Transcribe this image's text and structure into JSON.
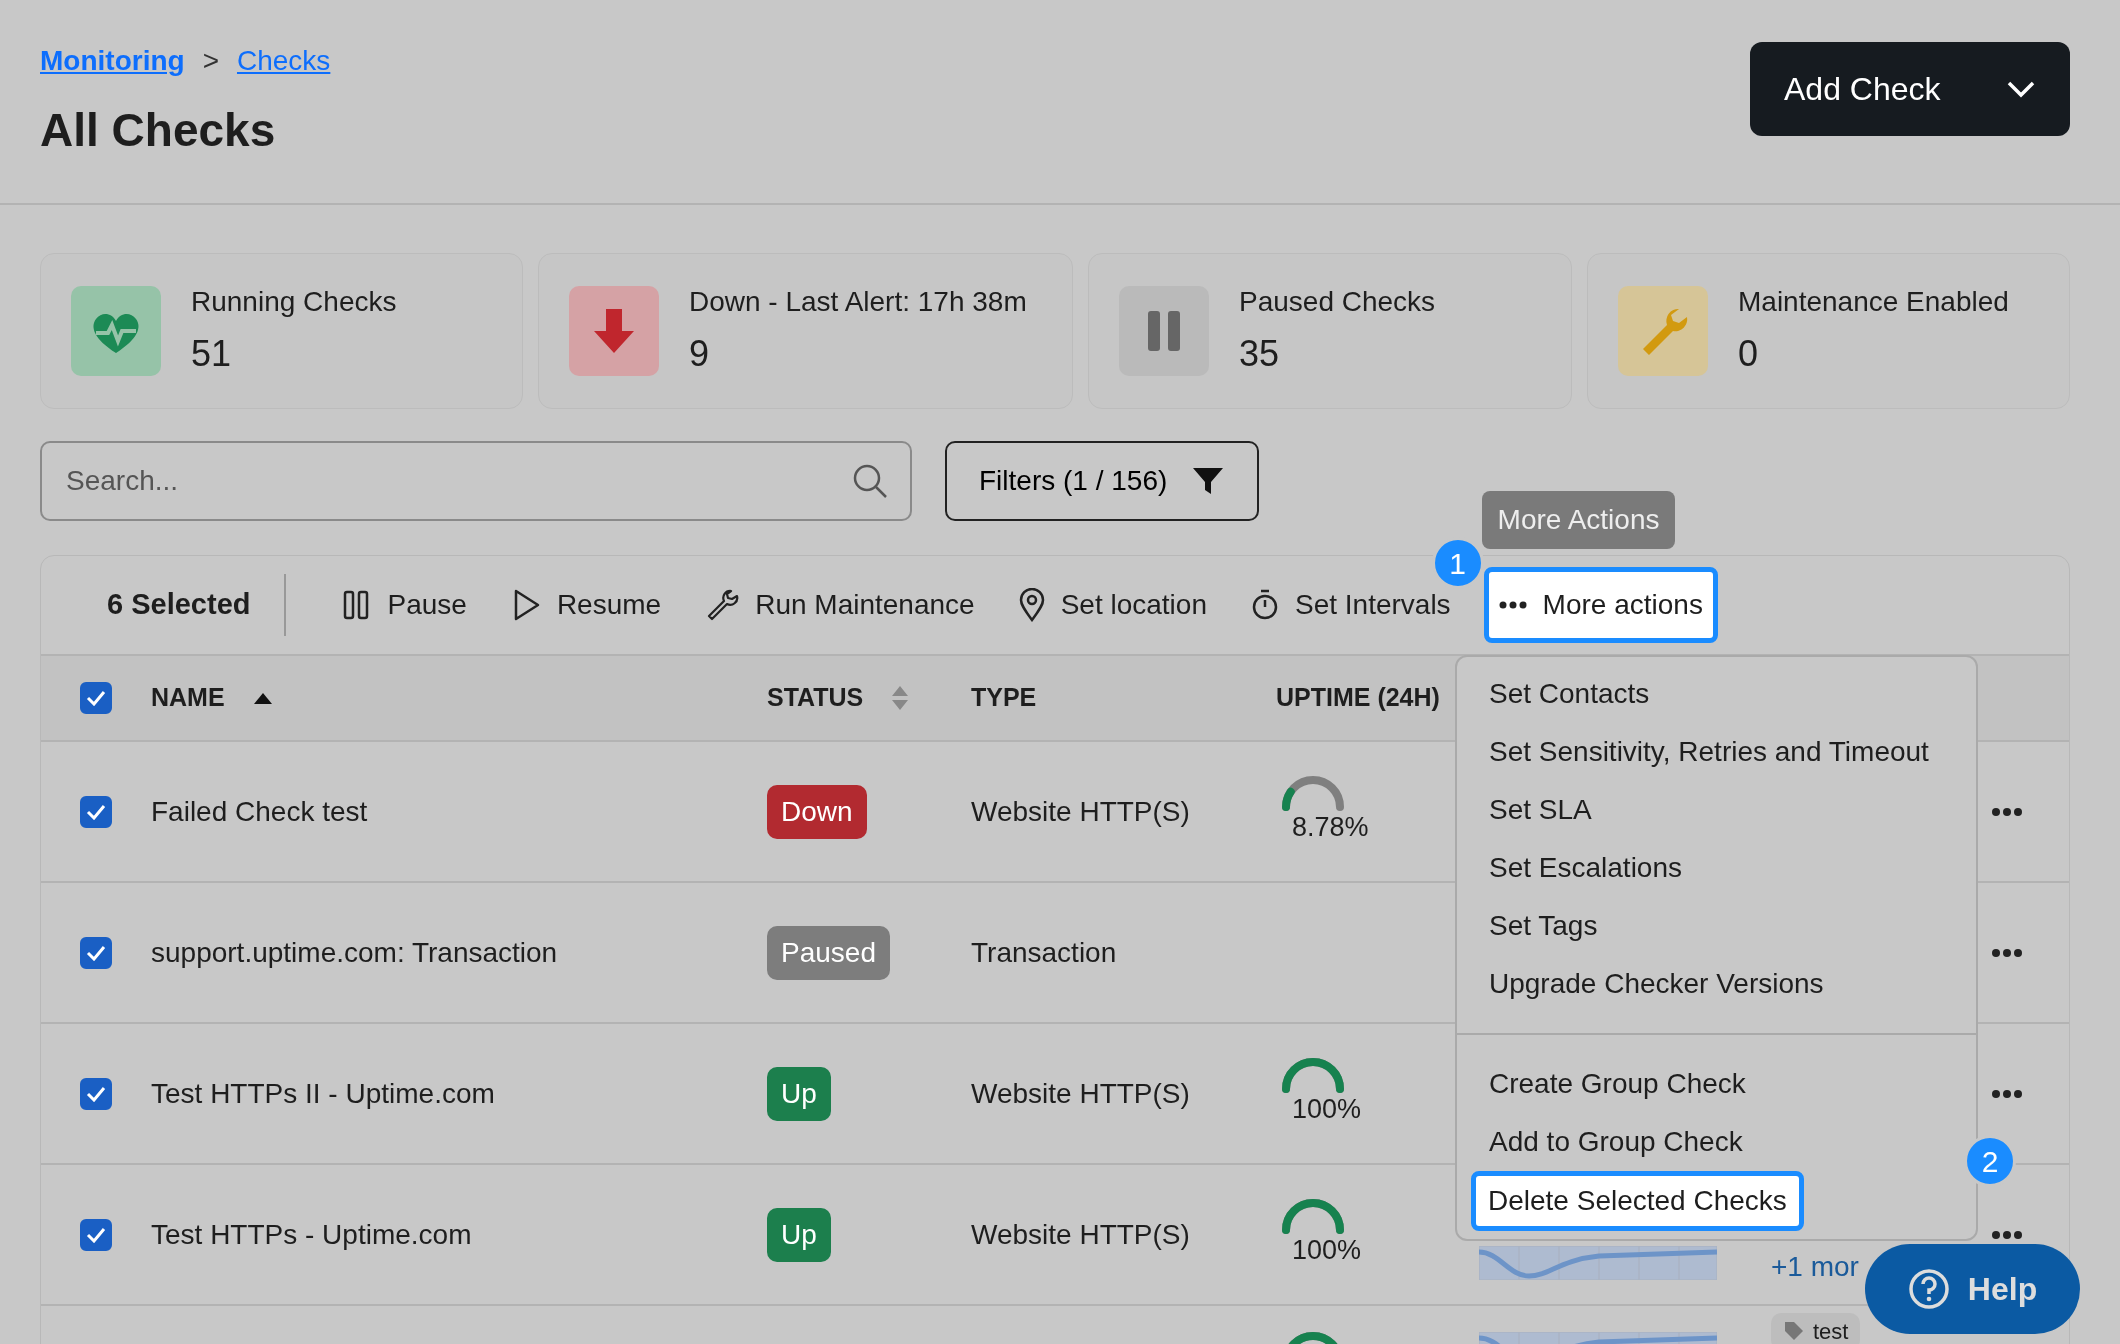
{
  "breadcrumb": [
    {
      "label": "Monitoring"
    },
    {
      "label": "Checks"
    }
  ],
  "breadcrumb_separator": ">",
  "title": "All Checks",
  "add_button": {
    "label": "Add Check"
  },
  "stats": [
    {
      "kind": "running",
      "label": "Running Checks",
      "value": "51"
    },
    {
      "kind": "down",
      "label": "Down - Last Alert: 17h 38m",
      "value": "9"
    },
    {
      "kind": "paused",
      "label": "Paused Checks",
      "value": "35"
    },
    {
      "kind": "maintenance",
      "label": "Maintenance Enabled",
      "value": "0"
    }
  ],
  "search": {
    "placeholder": "Search..."
  },
  "filters": {
    "label": "Filters (1 / 156)"
  },
  "toolbar": {
    "selected_count": "6 Selected",
    "actions": [
      {
        "kind": "pause",
        "label": "Pause",
        "highlighted": false
      },
      {
        "kind": "resume",
        "label": "Resume",
        "highlighted": false
      },
      {
        "kind": "maintenance",
        "label": "Run Maintenance",
        "highlighted": false
      },
      {
        "kind": "location",
        "label": "Set location",
        "highlighted": false
      },
      {
        "kind": "intervals",
        "label": "Set Intervals",
        "highlighted": false
      },
      {
        "kind": "more",
        "label": "More actions",
        "highlighted": true,
        "callout": "1",
        "tooltip": "More Actions"
      }
    ]
  },
  "table": {
    "select_all_checked": true,
    "columns": [
      {
        "label": "NAME",
        "sortable": true,
        "sorted": true
      },
      {
        "label": "STATUS",
        "sortable": true,
        "sorted": false
      },
      {
        "label": "TYPE",
        "sortable": false
      },
      {
        "label": "UPTIME (24H)",
        "sortable": false
      }
    ],
    "rows": [
      {
        "checked": true,
        "name": "Failed Check test",
        "status": "Down",
        "color": "#b22a30",
        "type": "Website HTTP(S)",
        "uptime": "8.78%",
        "level": 0.0878
      },
      {
        "checked": true,
        "name": "support.uptime.com: Transaction",
        "status": "Paused",
        "color": "#7d7d7d",
        "type": "Transaction"
      },
      {
        "checked": true,
        "name": "Test HTTPs II - Uptime.com",
        "status": "Up",
        "color": "#1c7f4d",
        "type": "Website HTTP(S)",
        "uptime": "100%",
        "level": 1
      },
      {
        "checked": true,
        "name": "Test HTTPs - Uptime.com",
        "status": "Up",
        "color": "#1c7f4d",
        "type": "Website HTTP(S)",
        "uptime": "100%",
        "level": 1,
        "sparkline": true,
        "more_tags": "+1 mor"
      },
      {
        "level": 1,
        "sparkline": true,
        "tag": "test"
      }
    ]
  },
  "menu": {
    "groups": [
      [
        {
          "label": "Set Contacts",
          "highlighted": false
        },
        {
          "label": "Set Sensitivity, Retries and Timeout",
          "highlighted": false
        },
        {
          "label": "Set SLA",
          "highlighted": false
        },
        {
          "label": "Set Escalations",
          "highlighted": false
        },
        {
          "label": "Set Tags",
          "highlighted": false
        },
        {
          "label": "Upgrade Checker Versions",
          "highlighted": false
        }
      ],
      [
        {
          "label": "Create Group Check",
          "highlighted": false
        },
        {
          "label": "Add to Group Check",
          "highlighted": false
        },
        {
          "label": "Delete Selected Checks",
          "highlighted": true,
          "callout": "2"
        }
      ]
    ]
  },
  "help_button": {
    "label": "Help"
  }
}
